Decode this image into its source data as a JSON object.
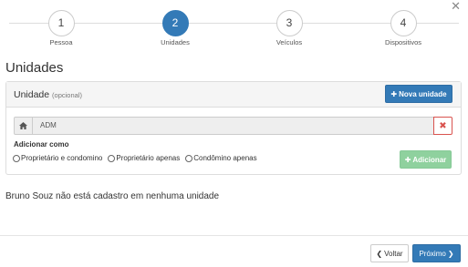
{
  "dialog": {
    "close_icon": "close-icon"
  },
  "stepper": {
    "steps": [
      {
        "number": "1",
        "label": "Pessoa",
        "active": false
      },
      {
        "number": "2",
        "label": "Unidades",
        "active": true
      },
      {
        "number": "3",
        "label": "Veículos",
        "active": false
      },
      {
        "number": "4",
        "label": "Dispositivos",
        "active": false
      }
    ]
  },
  "section": {
    "title": "Unidades"
  },
  "panel": {
    "title": "Unidade",
    "optional": "(opcional)",
    "new_button": "Nova unidade",
    "unit_value": "ADM",
    "add_as_label": "Adicionar como",
    "options": [
      "Proprietário e condomino",
      "Proprietário apenas",
      "Condômino apenas"
    ],
    "add_button": "Adicionar"
  },
  "message": "Bruno Souz não está cadastro em nenhuma unidade",
  "footer": {
    "back_label": "Voltar",
    "next_label": "Próximo"
  },
  "colors": {
    "primary": "#337ab7",
    "success_disabled": "#8fd19e",
    "danger": "#d9534f"
  }
}
